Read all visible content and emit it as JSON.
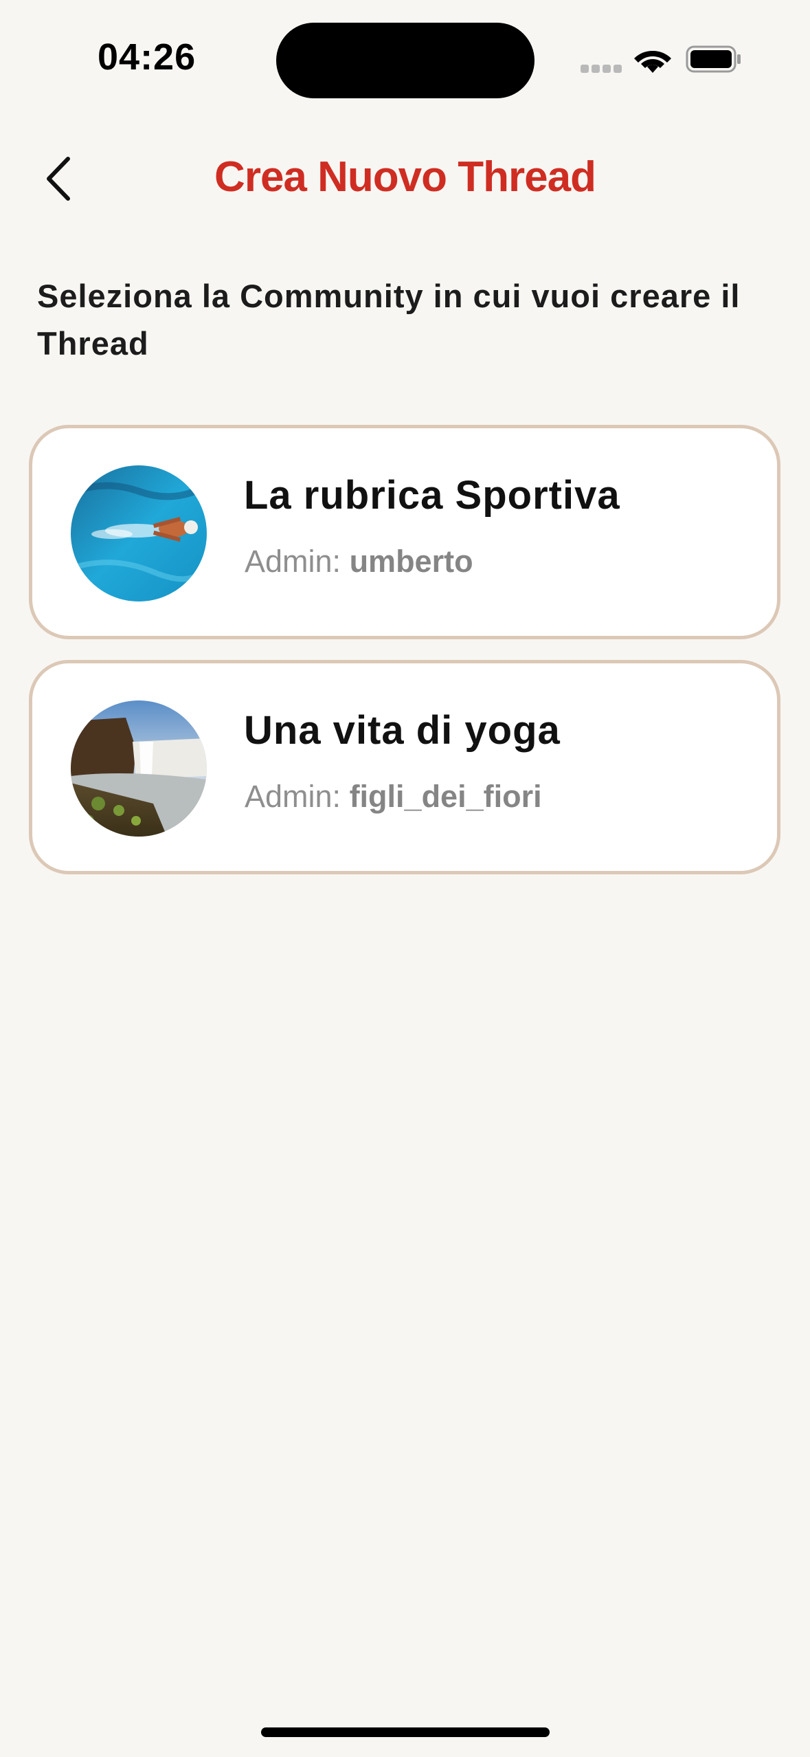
{
  "status_bar": {
    "time": "04:26"
  },
  "header": {
    "back_icon": "chevron-left-icon",
    "title": "Crea Nuovo Thread",
    "title_color": "#cf2d22"
  },
  "instruction": "Seleziona la Community in cui vuoi creare il Thread",
  "communities": [
    {
      "name": "La rubrica Sportiva",
      "admin_label": "Admin: ",
      "admin_name": "umberto",
      "avatar": "swimmer-photo"
    },
    {
      "name": "Una vita di yoga",
      "admin_label": "Admin: ",
      "admin_name": "figli_dei_fiori",
      "avatar": "waterfall-photo"
    }
  ],
  "colors": {
    "background": "#f8f6f2",
    "card_border": "#dcc8b6",
    "accent": "#cf2d22"
  }
}
